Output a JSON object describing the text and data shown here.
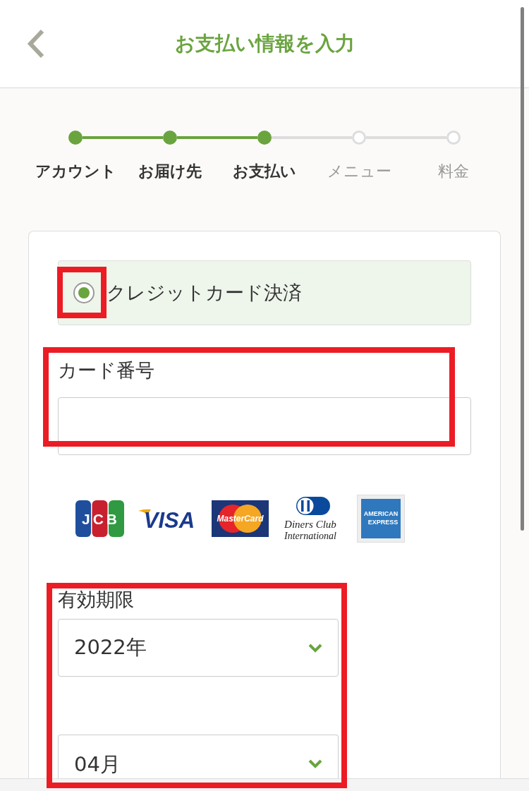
{
  "header": {
    "title": "お支払い情報を入力"
  },
  "steps": [
    {
      "label": "アカウント",
      "done": true
    },
    {
      "label": "お届け先",
      "done": true
    },
    {
      "label": "お支払い",
      "done": true
    },
    {
      "label": "メニュー",
      "done": false
    },
    {
      "label": "料金",
      "done": false
    }
  ],
  "payment_methods": [
    {
      "label": "クレジットカード決済",
      "selected": true,
      "annotated": true
    }
  ],
  "card_number": {
    "label": "カード番号",
    "annotated": true
  },
  "card_brands": [
    {
      "kind": "jcb",
      "lines": [
        "JCB"
      ]
    },
    {
      "kind": "visa",
      "lines": [
        "VISA"
      ]
    },
    {
      "kind": "mastercard",
      "lines": [
        "MasterCard"
      ]
    },
    {
      "kind": "diners",
      "lines": [
        "Diners Club",
        "International"
      ]
    },
    {
      "kind": "amex",
      "lines": [
        "AMERICAN",
        "EXPRESS"
      ]
    }
  ],
  "expiry": {
    "label": "有効期限",
    "annotated": true,
    "selects": [
      {
        "value": "2022年"
      },
      {
        "value": "04月"
      }
    ]
  }
}
